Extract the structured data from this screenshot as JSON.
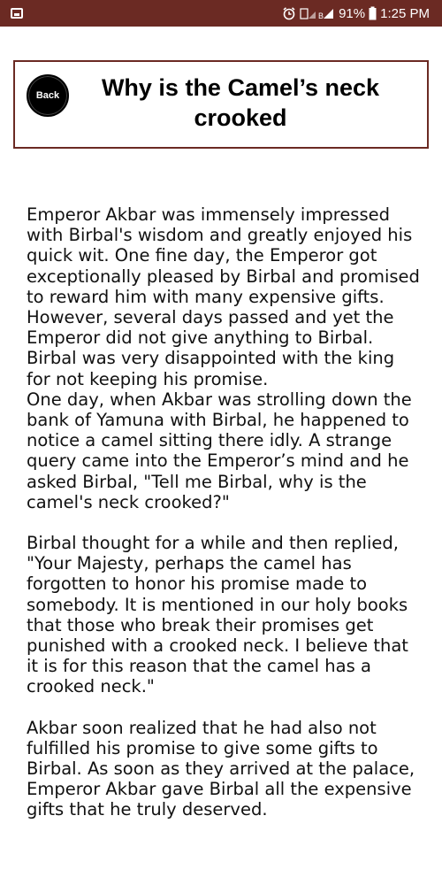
{
  "status_bar": {
    "battery": "91%",
    "time": "1:25 PM",
    "icons": [
      "gallery-icon",
      "alarm-icon",
      "signal-icon",
      "battery-icon"
    ]
  },
  "header": {
    "back_label": "Back",
    "title": "Why is the Camel’s neck crooked"
  },
  "story": {
    "paragraphs": [
      "Emperor Akbar was immensely impressed with Birbal's wisdom and greatly enjoyed his quick wit. One fine day, the Emperor got exceptionally pleased by Birbal and promised to reward him with many expensive gifts. However, several days passed and yet the Emperor did not give anything to Birbal. Birbal was very disappointed with the king for not keeping his promise.\nOne day, when Akbar was strolling down the bank of Yamuna with Birbal, he happened to notice a camel sitting there idly. A strange query came into the Emperor’s mind and he asked Birbal, \"Tell me Birbal, why is the camel's neck crooked?\"",
      "Birbal thought for a while and then replied, \"Your Majesty, perhaps the camel has forgotten to honor his promise made to somebody. It is mentioned in our holy books that those who break their promises get punished with a crooked neck. I believe that it is for this reason that the camel has a crooked neck.\"",
      "Akbar soon realized that he had also not fulfilled his promise to give some gifts to Birbal. As soon as they arrived at the palace, Emperor Akbar gave Birbal all the expensive gifts that he truly deserved."
    ]
  },
  "colors": {
    "status_bar": "#6b2a23",
    "header_border": "#6b2a23",
    "back_button": "#000000"
  }
}
